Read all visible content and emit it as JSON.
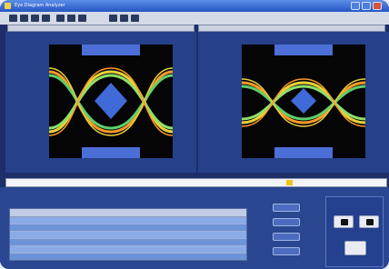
{
  "window": {
    "title": "Eye Diagram Analyzer"
  },
  "toolbar": {
    "icons": [
      "open-icon",
      "save-icon",
      "print-icon",
      "zoom-icon",
      "settings-icon",
      "run-icon",
      "stop-icon",
      "export-icon",
      "help-icon",
      "info-icon"
    ]
  },
  "panels": [
    {
      "id": "left",
      "tabs": [
        "",
        "",
        "",
        ""
      ]
    },
    {
      "id": "right",
      "tabs": [
        "",
        "",
        "",
        ""
      ]
    }
  ],
  "cmdbar": {
    "text": "",
    "value": ""
  },
  "table": {
    "headers": [
      "",
      "",
      "",
      "",
      "",
      ""
    ],
    "rows": [
      [
        "",
        "",
        "",
        "",
        "",
        ""
      ],
      [
        "",
        "",
        "",
        "",
        "",
        ""
      ],
      [
        "",
        "",
        "",
        "",
        "",
        ""
      ],
      [
        "",
        "",
        "",
        "",
        "",
        ""
      ],
      [
        "",
        "",
        "",
        "",
        "",
        ""
      ]
    ]
  },
  "side_buttons": [
    "",
    "",
    "",
    ""
  ],
  "controls": {
    "buttons": [
      "",
      ""
    ]
  },
  "colors": {
    "panel": "#26408a",
    "plot_bg": "#050505",
    "eye_center": "#3f6ad8",
    "mask": "#4b6fd6",
    "trace_yellow": "#e8d13a",
    "trace_green": "#5fd06a",
    "trace_orange": "#ff9a2a"
  }
}
